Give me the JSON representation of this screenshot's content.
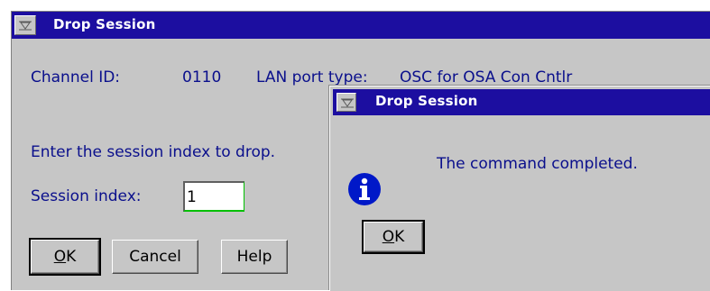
{
  "main_window": {
    "title": "Drop Session",
    "channel_id_label": "Channel ID:",
    "channel_id_value": "0110",
    "lan_port_type_label": "LAN port type:",
    "lan_port_type_value": "OSC for OSA Con Cntlr",
    "instruction": "Enter the session index to drop.",
    "session_index_label": "Session index:",
    "session_index_value": "1",
    "buttons": {
      "ok_prefix": "",
      "ok_mnemonic": "O",
      "ok_rest": "K",
      "cancel": "Cancel",
      "help": "Help"
    }
  },
  "message_dialog": {
    "title": "Drop Session",
    "message": "The command completed.",
    "icon": "info-icon",
    "ok_mnemonic": "O",
    "ok_rest": "K"
  },
  "colors": {
    "title_bar": "#1c0ea0",
    "window_bg": "#c6c6c6",
    "label_text": "#0a0f8c",
    "icon_blue": "#0018c8"
  }
}
